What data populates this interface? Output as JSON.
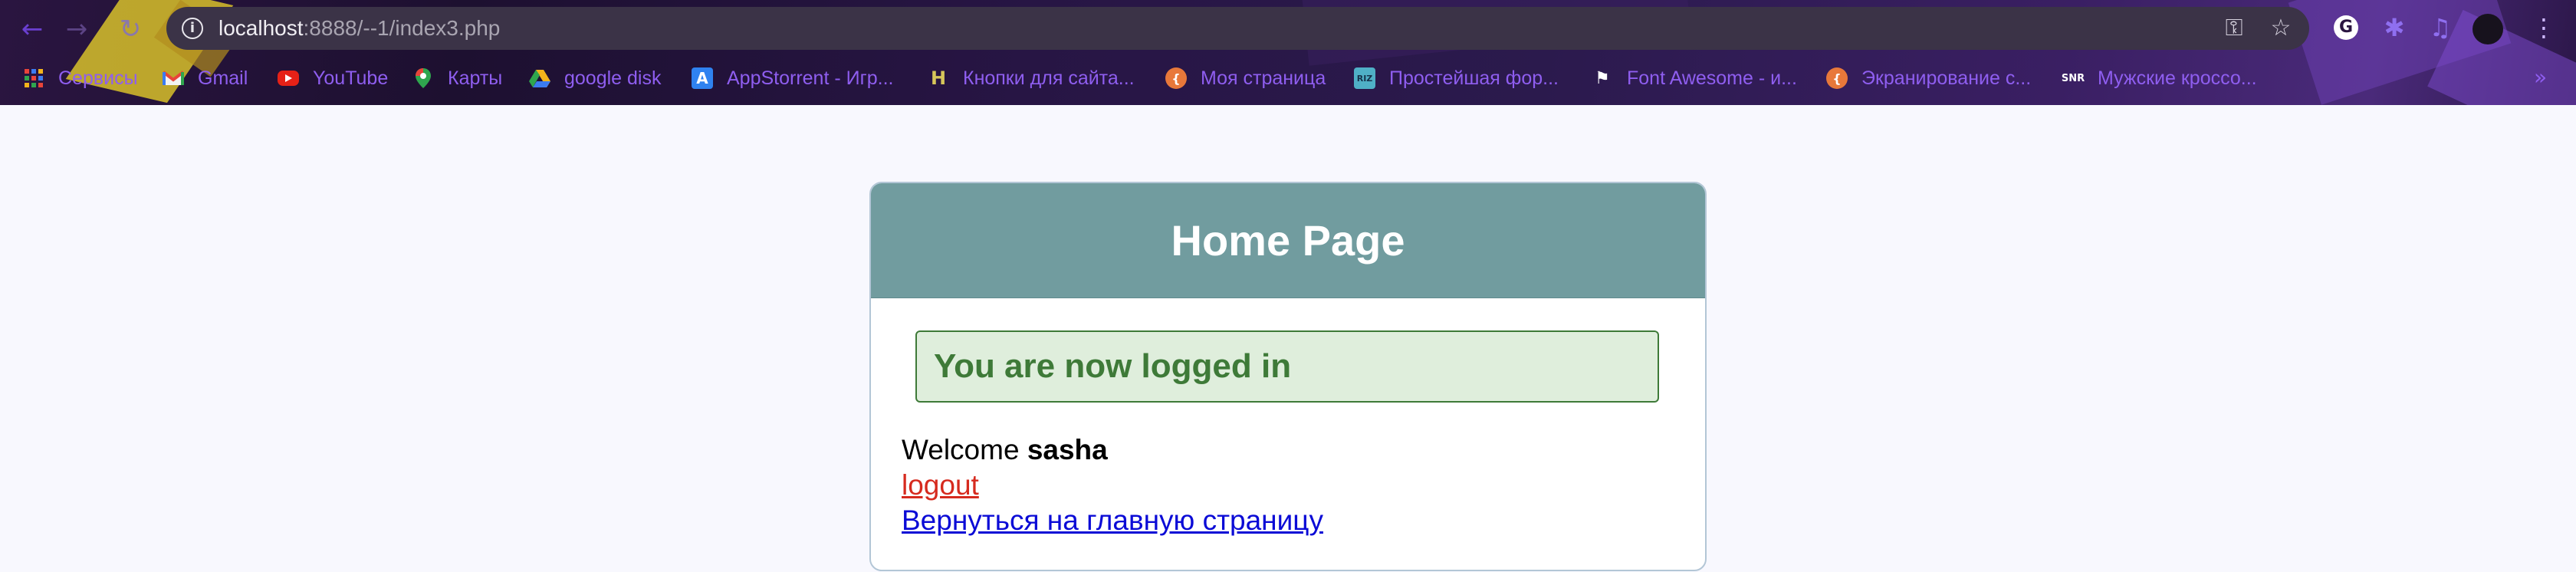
{
  "browser": {
    "url_host": "localhost",
    "url_rest": ":8888/--1/index3.php",
    "icons": {
      "back": "arrow-left-icon",
      "forward": "arrow-right-icon",
      "reload": "reload-icon",
      "info": "info-icon",
      "key": "key-icon",
      "star": "star-icon",
      "extension_g": "G",
      "puzzle": "puzzle-icon",
      "media": "music-queue-icon",
      "menu": "kebab-menu-icon"
    },
    "bookmarks": [
      {
        "label": "Сервисы",
        "icon": "apps-grid-icon"
      },
      {
        "label": "Gmail",
        "icon": "gmail-icon"
      },
      {
        "label": "YouTube",
        "icon": "youtube-icon"
      },
      {
        "label": "Карты",
        "icon": "maps-pin-icon"
      },
      {
        "label": "google disk",
        "icon": "google-drive-icon"
      },
      {
        "label": "AppStorrent - Игр...",
        "icon": "appstore-icon"
      },
      {
        "label": "Кнопки для сайта...",
        "icon": "h-logo-icon"
      },
      {
        "label": "Моя страница",
        "icon": "orange-hex-icon"
      },
      {
        "label": "Простейшая фор...",
        "icon": "riz-icon"
      },
      {
        "label": "Font Awesome - и...",
        "icon": "flag-icon"
      },
      {
        "label": "Экранирование с...",
        "icon": "orange-hex-icon"
      },
      {
        "label": "Мужские кроссо...",
        "icon": "snr-logo-icon"
      }
    ],
    "bookmarks_more": "»",
    "colors": {
      "accent": "#8f5ef0",
      "chrome_bg": "#2a1540"
    }
  },
  "page": {
    "title": "Home Page",
    "success_message": "You are now logged in",
    "welcome_prefix": "Welcome ",
    "username": "sasha",
    "logout_label": "logout",
    "home_link_label": "Вернуться на главную страницу",
    "colors": {
      "header": "#719c9f",
      "success_bg": "#dfeedc",
      "success_text": "#3e7a38",
      "logout": "#d62a1e",
      "link": "#0b0bd6",
      "page_bg": "#f8f8fe"
    }
  }
}
